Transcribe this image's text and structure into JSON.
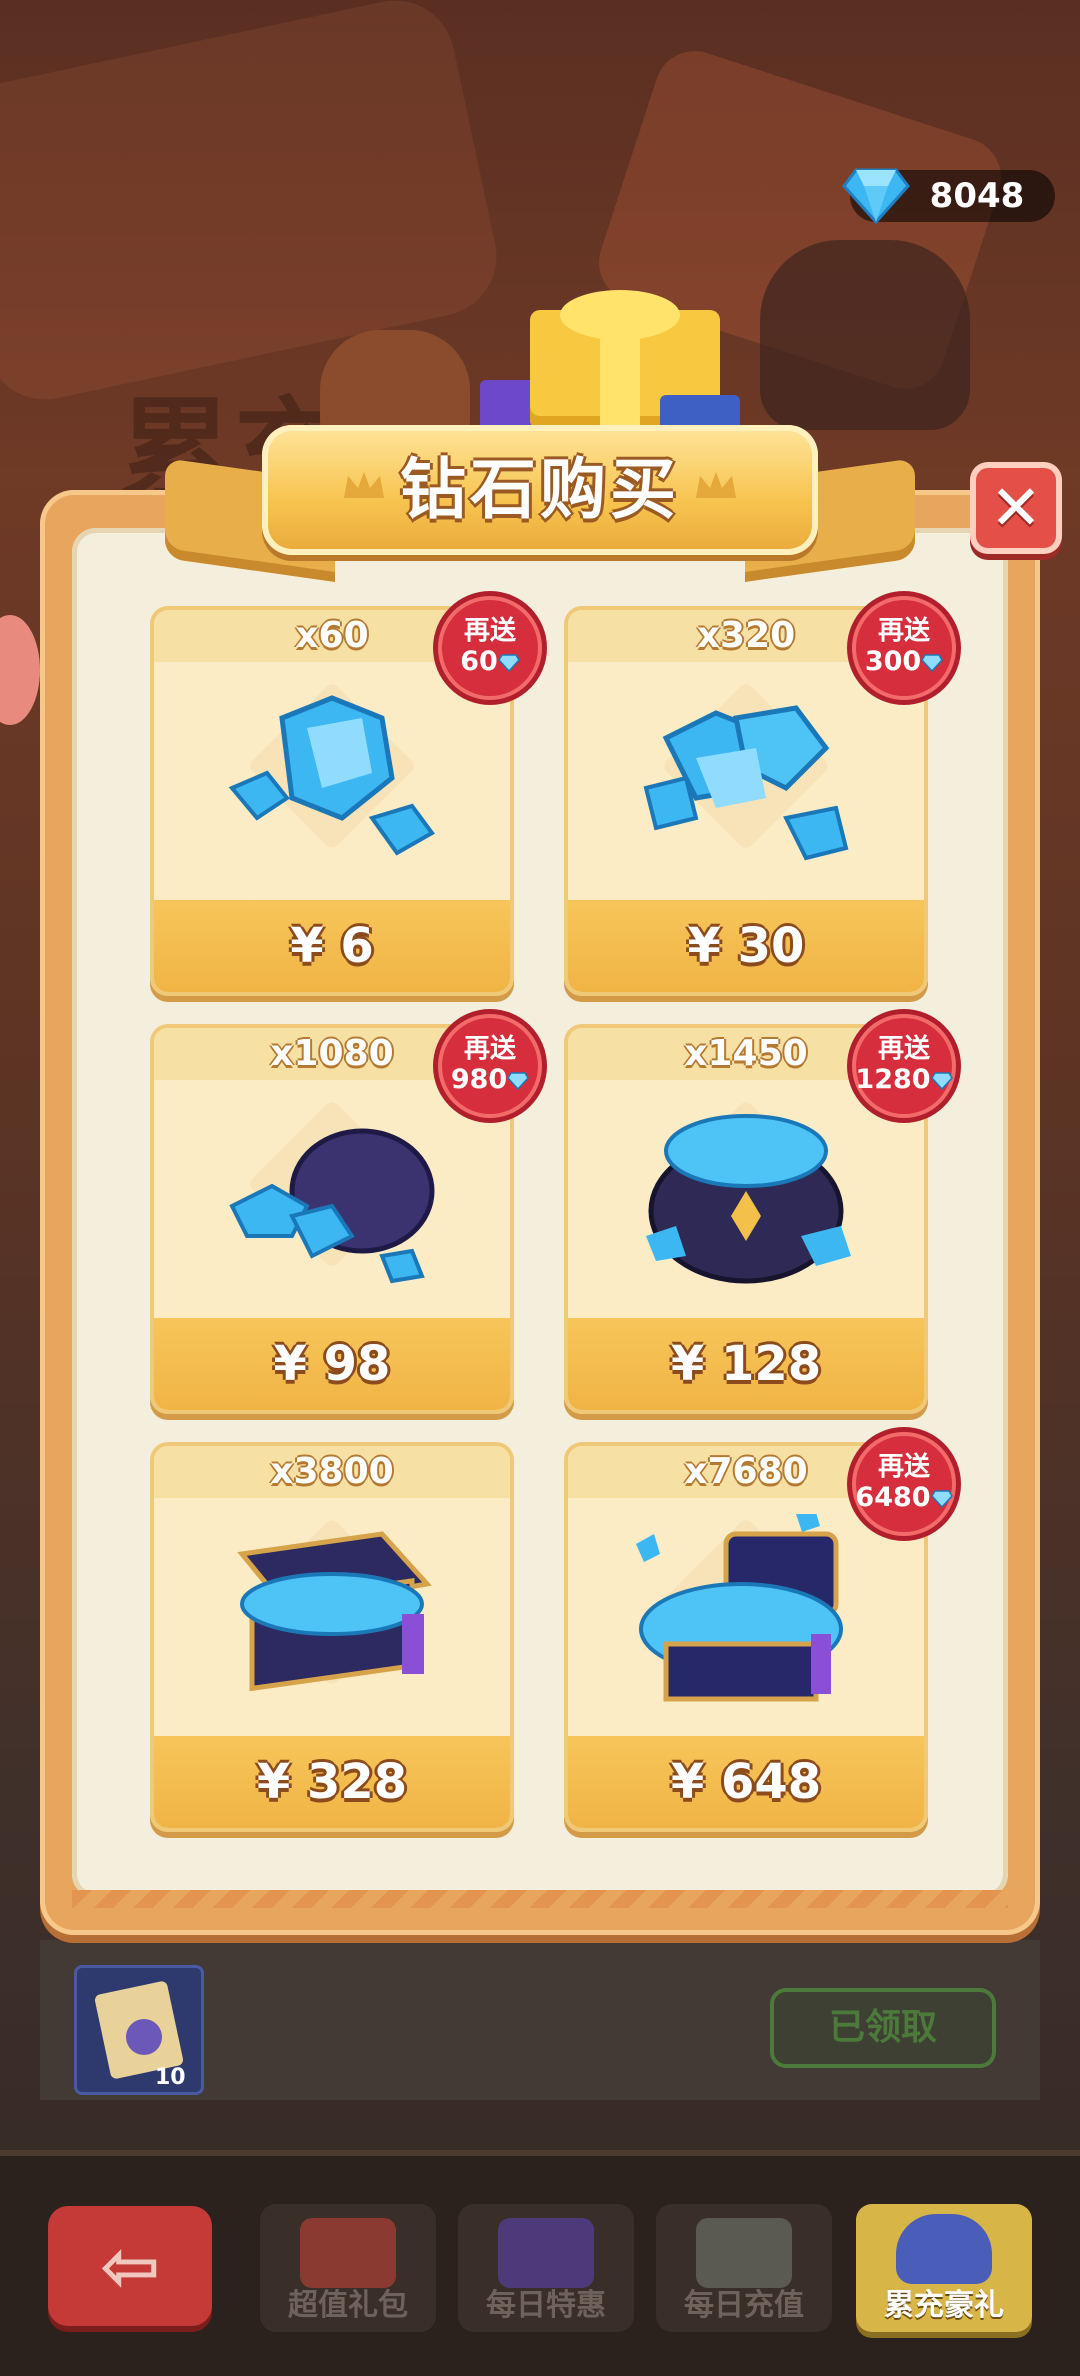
{
  "header": {
    "currency_value": "8048",
    "currency_icon": "diamond-icon"
  },
  "popup": {
    "title": "钻石购买",
    "close_icon": "close-icon",
    "products": [
      {
        "quantity": "x60",
        "price": "¥ 6",
        "bonus_label": "再送",
        "bonus_amount": "60",
        "art": "small-gems"
      },
      {
        "quantity": "x320",
        "price": "¥ 30",
        "bonus_label": "再送",
        "bonus_amount": "300",
        "art": "gem-pile"
      },
      {
        "quantity": "x1080",
        "price": "¥ 98",
        "bonus_label": "再送",
        "bonus_amount": "980",
        "art": "gem-pouch"
      },
      {
        "quantity": "x1450",
        "price": "¥ 128",
        "bonus_label": "再送",
        "bonus_amount": "1280",
        "art": "gem-sack"
      },
      {
        "quantity": "x3800",
        "price": "¥ 328",
        "art": "gem-chest"
      },
      {
        "quantity": "x7680",
        "price": "¥ 648",
        "bonus_label": "再送",
        "bonus_amount": "6480",
        "art": "treasure-chest"
      }
    ]
  },
  "background": {
    "panel_title": "累充",
    "reward_item_count": "10",
    "claimed_label": "已领取"
  },
  "bottom_nav": {
    "back_icon": "back-arrow-icon",
    "tabs": [
      {
        "label": "超值礼包",
        "active": false
      },
      {
        "label": "每日特惠",
        "active": false
      },
      {
        "label": "每日充值",
        "active": false
      },
      {
        "label": "累充豪礼",
        "active": true
      }
    ]
  },
  "colors": {
    "accent_gold": "#f7c34e",
    "badge_red": "#d62e3c",
    "gem_blue": "#3cb7f2",
    "close_red": "#e45048"
  }
}
